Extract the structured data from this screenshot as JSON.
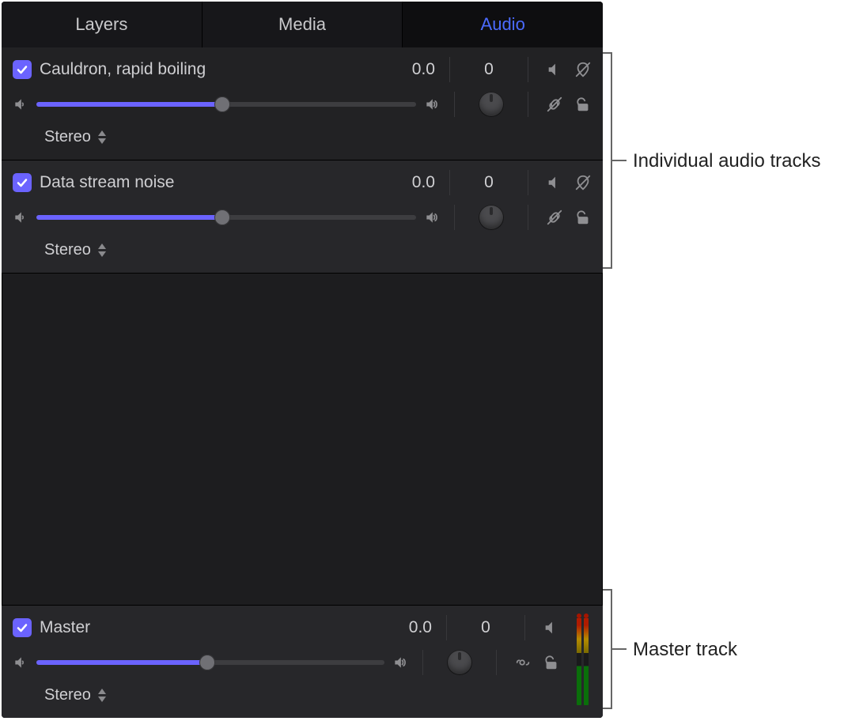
{
  "tabs": {
    "layers": "Layers",
    "media": "Media",
    "audio": "Audio"
  },
  "tracks": [
    {
      "name": "Cauldron, rapid boiling",
      "level_value": "0.0",
      "pan_value": "0",
      "mode": "Stereo",
      "slider_pct": 49
    },
    {
      "name": "Data stream noise",
      "level_value": "0.0",
      "pan_value": "0",
      "mode": "Stereo",
      "slider_pct": 49
    }
  ],
  "master": {
    "name": "Master",
    "level_value": "0.0",
    "pan_value": "0",
    "mode": "Stereo",
    "slider_pct": 49
  },
  "annotations": {
    "individual": "Individual audio tracks",
    "master": "Master track"
  }
}
